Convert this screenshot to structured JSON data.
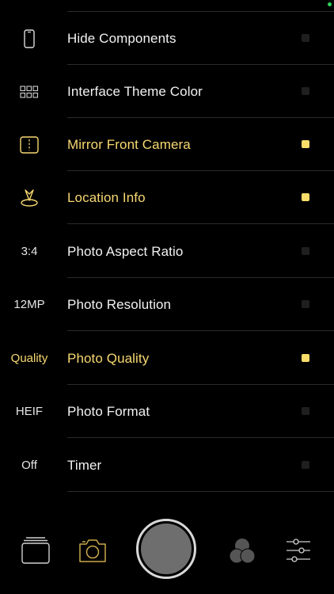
{
  "colors": {
    "accent": "#F7D870",
    "background": "#000000",
    "text": "#F2F2F2",
    "status": "#30D158"
  },
  "settings": {
    "rows": [
      {
        "icon": "phone-outline-icon",
        "icon_text": "",
        "label": "Hide Components",
        "active": false
      },
      {
        "icon": "grid-icon",
        "icon_text": "",
        "label": "Interface Theme Color",
        "active": false
      },
      {
        "icon": "mirror-split-icon",
        "icon_text": "",
        "label": "Mirror Front Camera",
        "active": true
      },
      {
        "icon": "location-pin-icon",
        "icon_text": "",
        "label": "Location Info",
        "active": true
      },
      {
        "icon": "",
        "icon_text": "3:4",
        "label": "Photo Aspect Ratio",
        "active": false
      },
      {
        "icon": "",
        "icon_text": "12MP",
        "label": "Photo Resolution",
        "active": false
      },
      {
        "icon": "",
        "icon_text": "Quality",
        "label": "Photo Quality",
        "active": true
      },
      {
        "icon": "",
        "icon_text": "HEIF",
        "label": "Photo Format",
        "active": false
      },
      {
        "icon": "",
        "icon_text": "Off",
        "label": "Timer",
        "active": false
      }
    ]
  },
  "bottom_bar": {
    "tabs": [
      "gallery-icon",
      "camera-icon",
      "shutter-button",
      "filters-icon",
      "sliders-icon"
    ]
  }
}
